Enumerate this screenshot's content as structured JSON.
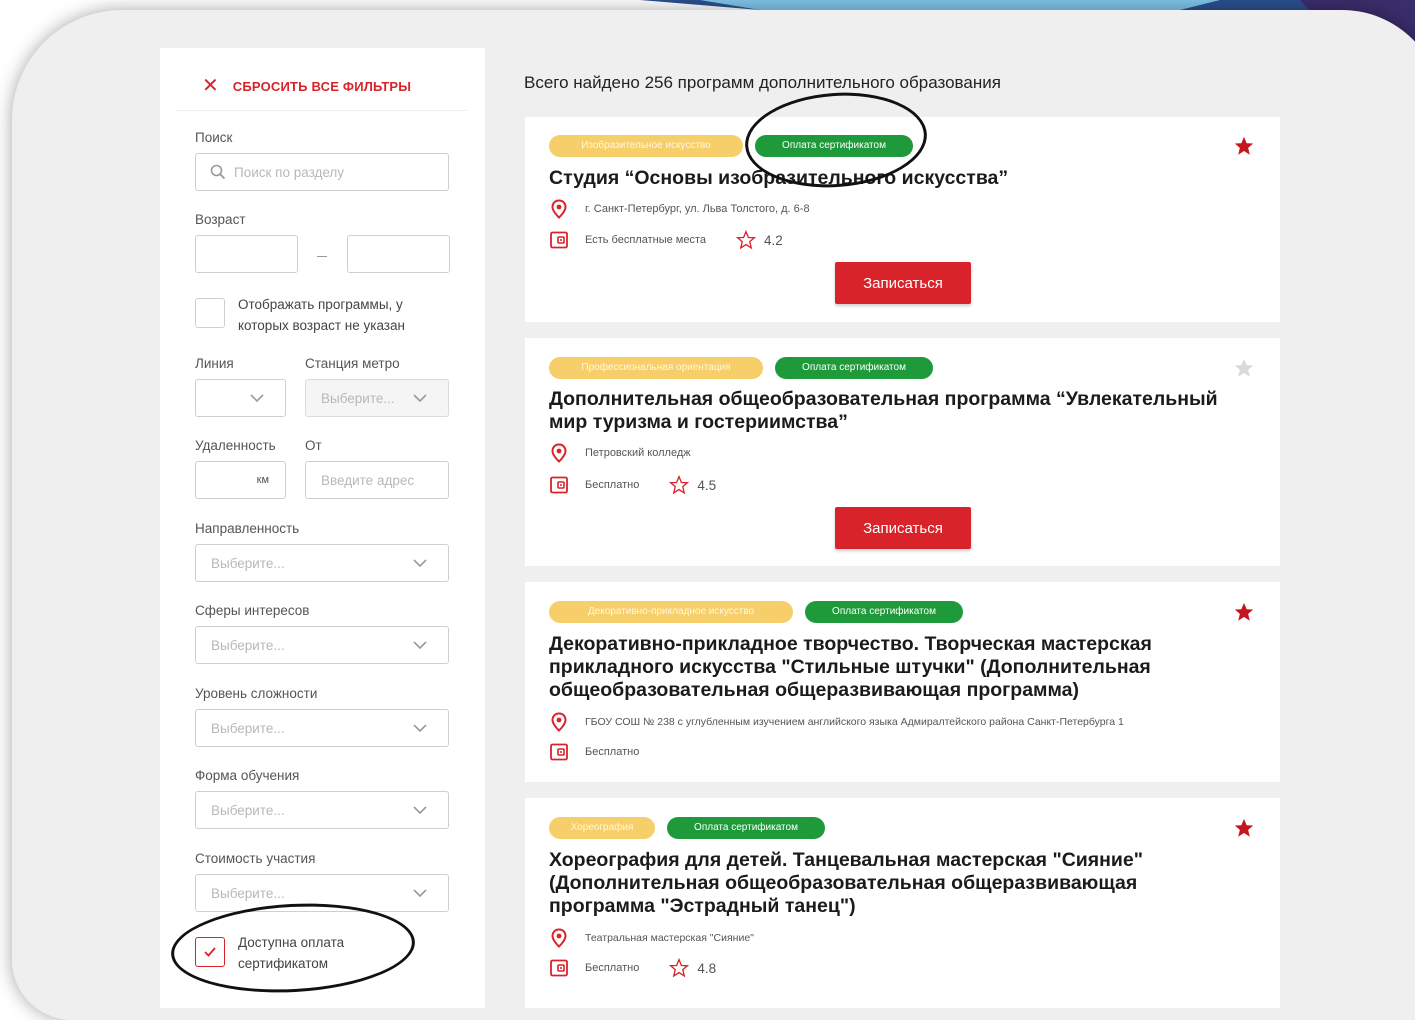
{
  "colors": {
    "accent": "#d8232a",
    "tag_green": "#1f9a3a",
    "tag_yellow": "#f7cf6a",
    "frame_bg": "#efefef"
  },
  "filters": {
    "reset_label": "СБРОСИТЬ ВСЕ ФИЛЬТРЫ",
    "search": {
      "label": "Поиск",
      "placeholder": "Поиск по разделу"
    },
    "age": {
      "label": "Возраст",
      "separator": "–"
    },
    "show_no_age": {
      "label": "Отображать программы, у которых возраст не указан",
      "checked": false
    },
    "line": {
      "label": "Линия"
    },
    "metro": {
      "label": "Станция метро",
      "placeholder": "Выберите..."
    },
    "distance": {
      "label": "Удаленность",
      "unit": "км"
    },
    "from": {
      "label": "От",
      "placeholder": "Введите адрес"
    },
    "direction": {
      "label": "Направленность",
      "placeholder": "Выберите..."
    },
    "interests": {
      "label": "Сферы интересов",
      "placeholder": "Выберите..."
    },
    "level": {
      "label": "Уровень сложности",
      "placeholder": "Выберите..."
    },
    "form": {
      "label": "Форма обучения",
      "placeholder": "Выберите..."
    },
    "cost": {
      "label": "Стоимость участия",
      "placeholder": "Выберите..."
    },
    "certificate": {
      "label": "Доступна оплата сертификатом",
      "checked": true
    }
  },
  "results": {
    "total_text": "Всего найдено 256 программ дополнительного образования",
    "cards": [
      {
        "category": "Изобразительное искусство",
        "payment": "Оплата сертификатом",
        "title": "Студия “Основы изобразительного искусства”",
        "location": "г. Санкт-Петербург, ул. Льва Толстого, д. 6-8",
        "price": "Есть бесплатные места",
        "rating": "4.2",
        "button": "Записаться",
        "favorite": true
      },
      {
        "category": "Профессиональная ориентация",
        "payment": "Оплата сертификатом",
        "title": "Дополнительная общеобразовательная программа “Увлекательный мир туризма и гостериимства”",
        "location": "Петровский колледж",
        "price": "Бесплатно",
        "rating": "4.5",
        "button": "Записаться",
        "favorite": false
      },
      {
        "category": "Декоративно-прикладное искусство",
        "payment": "Оплата сертификатом",
        "title": "Декоративно-прикладное творчество. Творческая мастерская прикладного искусства \"Стильные штучки\" (Дополнительная общеобразовательная общеразвивающая программа)",
        "location": "ГБОУ СОШ № 238 с углубленным изучением английского языка Адмиралтейского района Санкт-Петербурга 1",
        "price": "Бесплатно",
        "favorite": true
      },
      {
        "category": "Хореография",
        "payment": "Оплата сертификатом",
        "title": "Хореография для детей. Танцевальная мастерская \"Сияние\" (Дополнительная общеобразовательная общеразвивающая программа \"Эстрадный танец\")",
        "location": "Театральная мастерская \"Сияние\"",
        "price": "Бесплатно",
        "rating": "4.8",
        "favorite": true
      }
    ]
  }
}
